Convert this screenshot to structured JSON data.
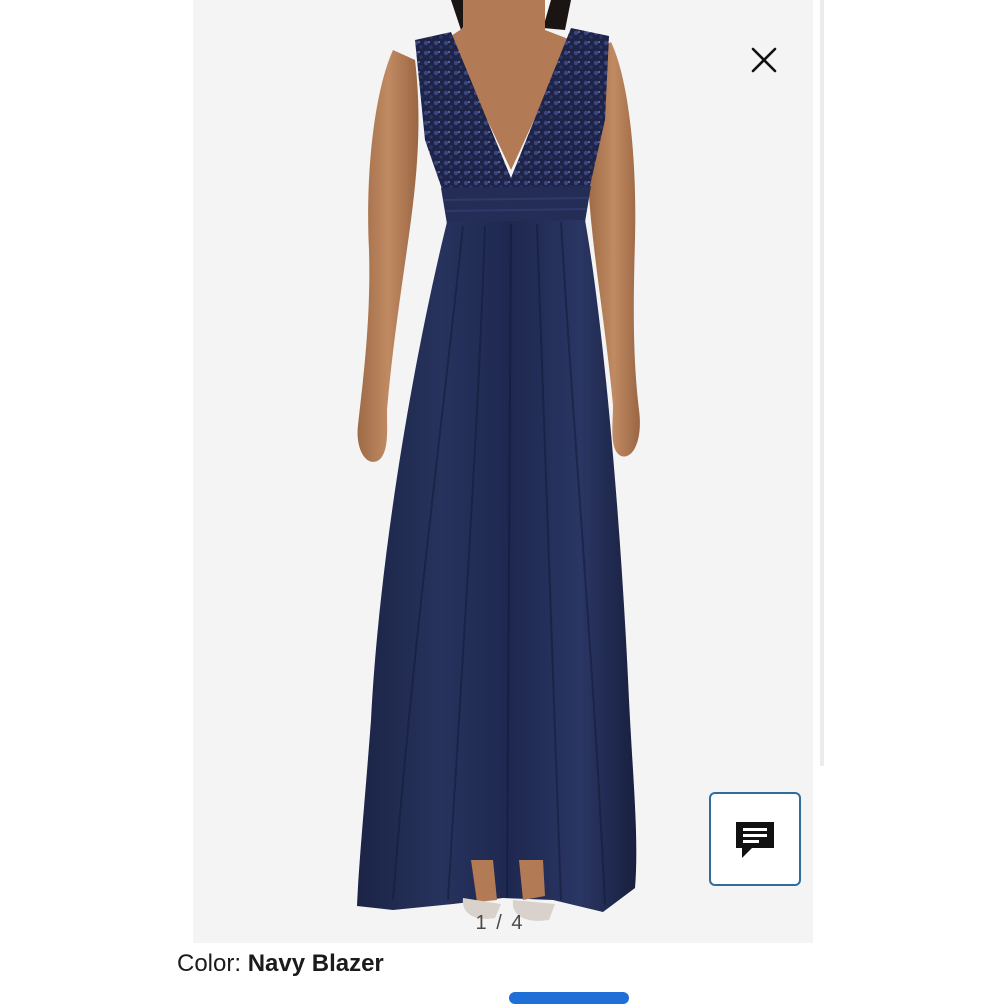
{
  "gallery": {
    "product_photo": "Navy sleeveless plunge-neck sequin-bodice chiffon maxi gown",
    "counter": "1 / 4"
  },
  "icons": {
    "close": "close-icon",
    "chat": "chat-icon"
  },
  "color_selector": {
    "label": "Color: ",
    "value": "Navy Blazer"
  },
  "colors": {
    "gown": "#1f2a4d",
    "skin": "#b27a55",
    "chat_border": "#2f6e9a",
    "pill": "#1f6fd6"
  }
}
